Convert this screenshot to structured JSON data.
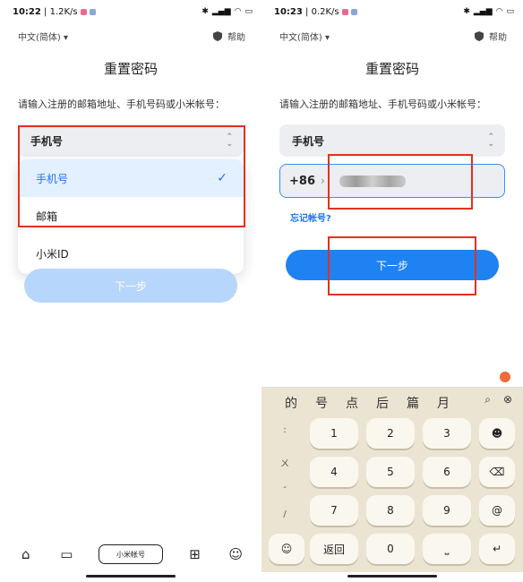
{
  "left": {
    "status": {
      "time": "10:22",
      "speed": "1.2K/s"
    },
    "language": "中文(简体)",
    "help": "帮助",
    "title": "重置密码",
    "prompt": "请输入注册的邮箱地址、手机号码或小米帐号：",
    "selected": "手机号",
    "options": [
      "手机号",
      "邮箱",
      "小米ID"
    ],
    "next": "下一步",
    "nav_center": "小米帐号"
  },
  "right": {
    "status": {
      "time": "10:23",
      "speed": "0.2K/s"
    },
    "language": "中文(简体)",
    "help": "帮助",
    "title": "重置密码",
    "prompt": "请输入注册的邮箱地址、手机号码或小米帐号：",
    "selected": "手机号",
    "country_code": "+86",
    "forgot": "忘记帐号?",
    "next": "下一步",
    "candidates": [
      "的",
      "号",
      "点",
      "后",
      "篇",
      "月"
    ],
    "symbols": [
      ":",
      "ㄨ",
      "-",
      "/"
    ],
    "keys": [
      "1",
      "2",
      "3",
      "4",
      "5",
      "6",
      "7",
      "8",
      "9",
      "返回",
      "0"
    ]
  },
  "colors": {
    "accent": "#1f82f2",
    "highlight": "#e0321f"
  }
}
